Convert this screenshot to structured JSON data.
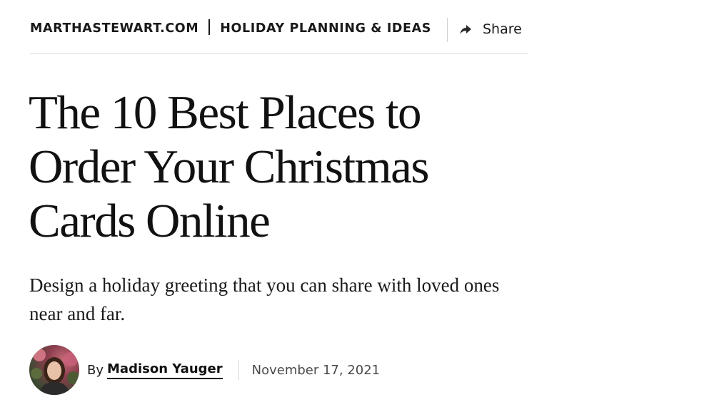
{
  "breadcrumb": {
    "site": "MARTHASTEWART.COM",
    "section": "HOLIDAY PLANNING & IDEAS"
  },
  "share": {
    "label": "Share",
    "icon": "share-arrow-icon"
  },
  "article": {
    "title": "The 10 Best Places to Order Your Christmas Cards Online",
    "dek": "Design a holiday greeting that you can share with loved ones near and far.",
    "byline_prefix": "By",
    "author": "Madison Yauger",
    "date": "November 17, 2021"
  },
  "colors": {
    "text": "#111111",
    "muted": "#4a4a4a",
    "rule": "#dcdcdc"
  }
}
